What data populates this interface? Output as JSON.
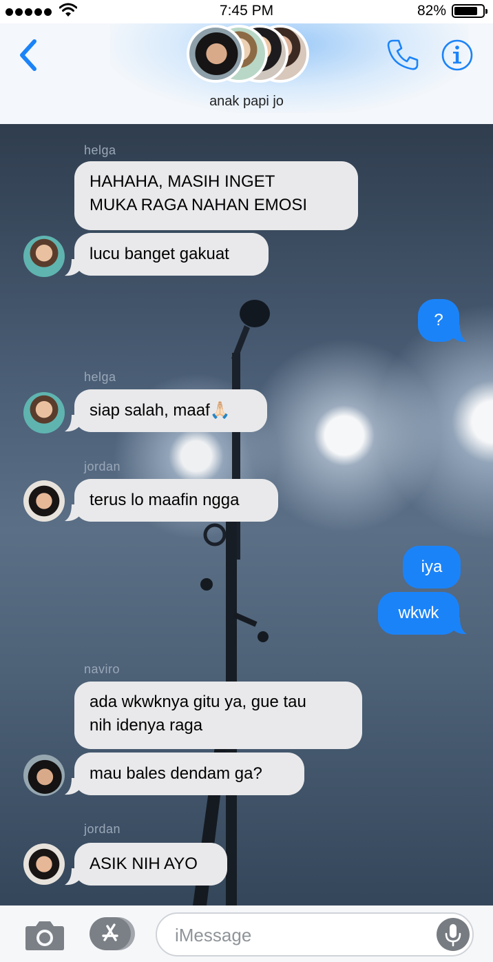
{
  "status_bar": {
    "time": "7:45 PM",
    "battery_percent": "82%",
    "battery_level": 0.82,
    "signal_bars": 5
  },
  "header": {
    "group_name": "anak papi jo",
    "back_icon": "chevron-left-icon",
    "call_icon": "phone-icon",
    "info_icon": "info-icon",
    "accent_color": "#1b83f8"
  },
  "messages": [
    {
      "sender": "helga",
      "text_lines": [
        "HAHAHA, MASIH INGET",
        "MUKA RAGA NAHAN EMOSI"
      ],
      "direction": "incoming"
    },
    {
      "text": "lucu banget gakuat",
      "direction": "incoming"
    },
    {
      "text": "?",
      "direction": "outgoing"
    },
    {
      "sender": "helga",
      "text": "siap salah, maaf🙏🏻",
      "direction": "incoming"
    },
    {
      "sender": "jordan",
      "text": "terus lo maafin ngga",
      "direction": "incoming"
    },
    {
      "text": "iya",
      "direction": "outgoing"
    },
    {
      "text": "wkwk",
      "direction": "outgoing"
    },
    {
      "sender": "naviro",
      "text_lines": [
        "ada wkwknya gitu ya, gue tau",
        "nih idenya raga"
      ],
      "direction": "incoming"
    },
    {
      "text": "mau bales dendam ga?",
      "direction": "incoming"
    },
    {
      "sender": "jordan",
      "text": "ASIK NIH AYO",
      "direction": "incoming"
    }
  ],
  "input_bar": {
    "placeholder": "iMessage",
    "camera_icon": "camera-icon",
    "apps_icon": "app-store-icon",
    "dictation_icon": "microphone-icon"
  }
}
